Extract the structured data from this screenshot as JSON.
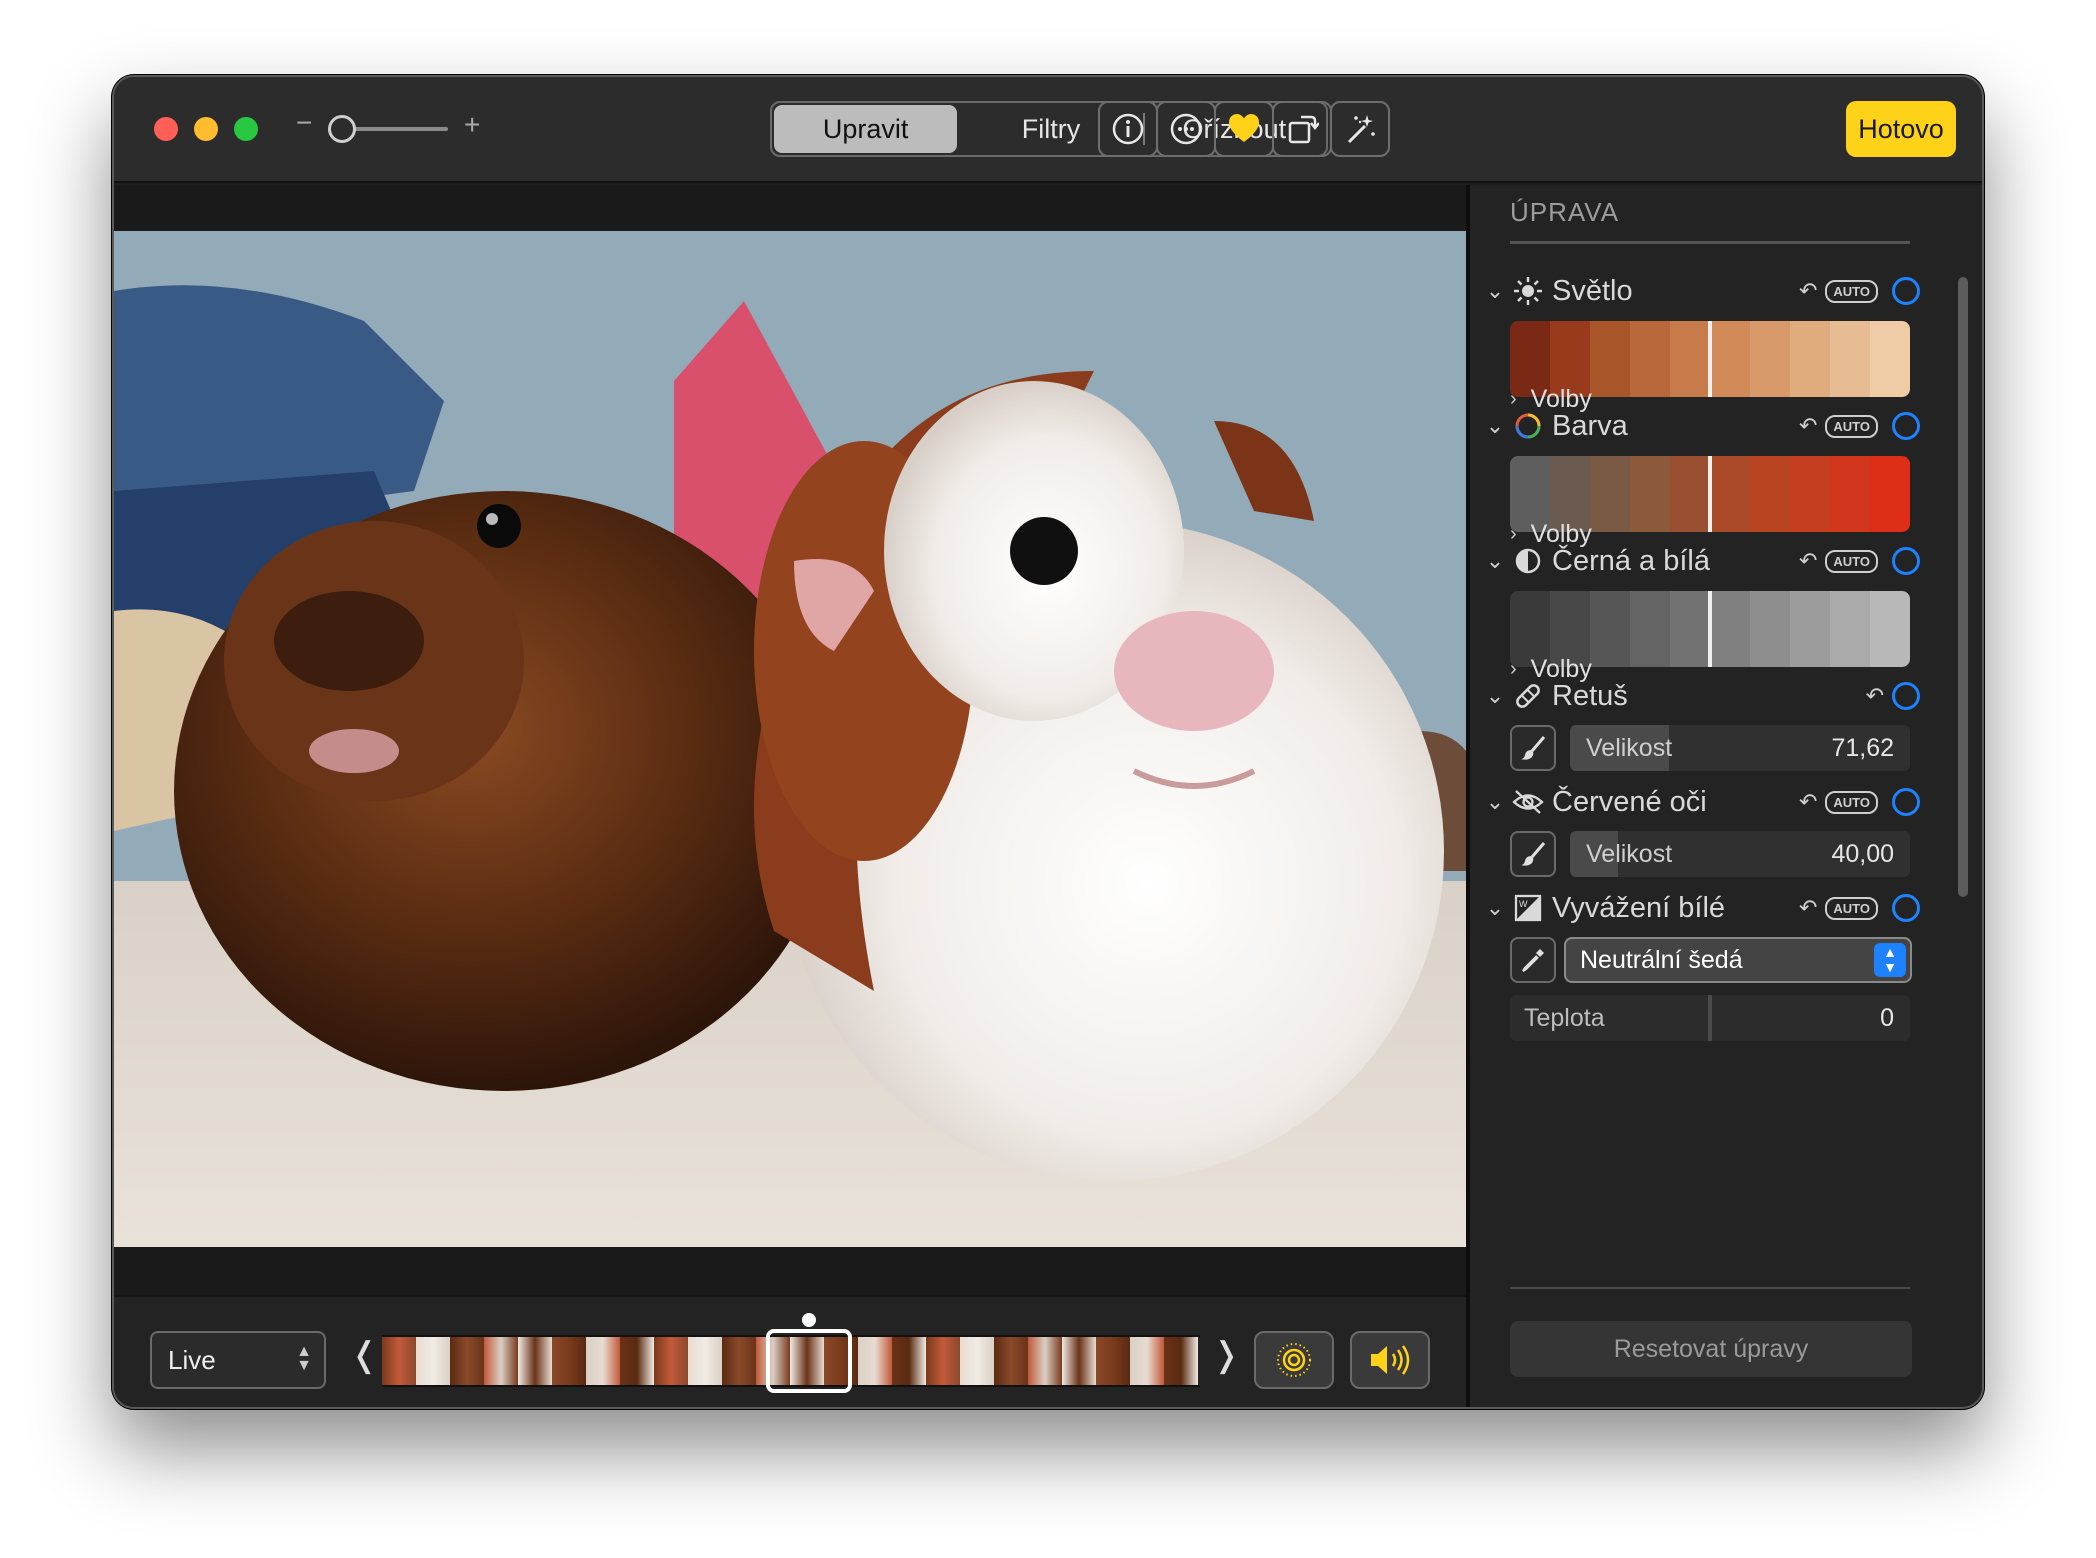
{
  "toolbar": {
    "zoom_minus": "−",
    "zoom_plus": "+",
    "zoom_level": 0.05,
    "tabs": [
      {
        "label": "Upravit",
        "active": true
      },
      {
        "label": "Filtry",
        "active": false
      },
      {
        "label": "Oříznout",
        "active": false
      }
    ],
    "icons": [
      "info-icon",
      "more-icon",
      "heart-icon",
      "rotate-icon",
      "magic-wand-icon"
    ],
    "done_label": "Hotovo",
    "accent_color": "#ffd21a"
  },
  "bottombar": {
    "live_label": "Live",
    "prev_arrow": "❬",
    "next_arrow": "❭",
    "icons": [
      "live-photo-icon",
      "sound-icon"
    ]
  },
  "panel": {
    "title": "ÚPRAVA",
    "auto_label": "AUTO",
    "sections": [
      {
        "label": "Světlo",
        "icon": "sun-icon",
        "options_label": "Volby"
      },
      {
        "label": "Barva",
        "icon": "color-ring-icon",
        "options_label": "Volby"
      },
      {
        "label": "Černá a bílá",
        "icon": "half-circle-icon",
        "options_label": "Volby"
      },
      {
        "label": "Retuš",
        "icon": "bandage-icon",
        "slider_label": "Velikost",
        "slider_value": "71,62",
        "slider_fill": 0.29
      },
      {
        "label": "Červené oči",
        "icon": "eye-slash-icon",
        "slider_label": "Velikost",
        "slider_value": "40,00",
        "slider_fill": 0.14
      },
      {
        "label": "Vyvážení bílé",
        "icon": "white-balance-icon",
        "select_value": "Neutrální šedá",
        "temp_label": "Teplota",
        "temp_value": "0"
      }
    ],
    "reset_label": "Resetovat úpravy",
    "ring_color": "#1e82ff"
  }
}
